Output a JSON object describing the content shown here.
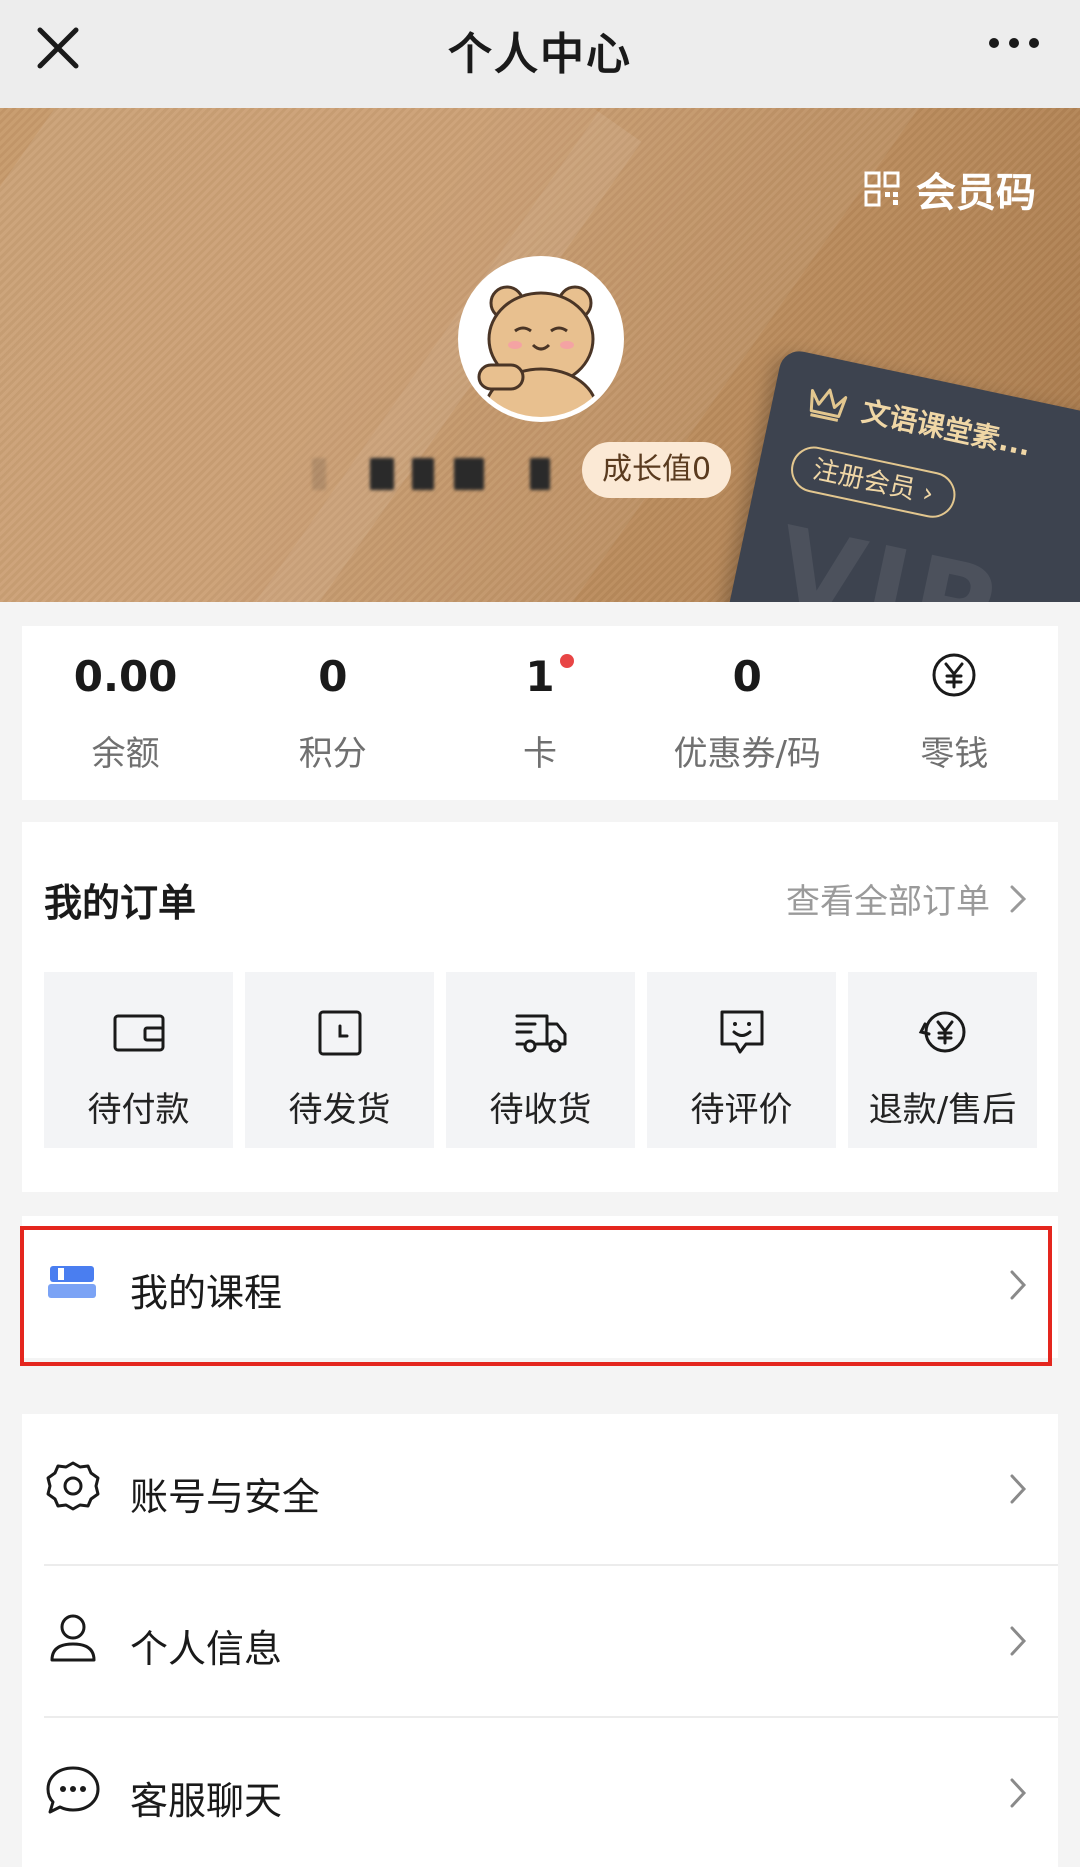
{
  "topbar": {
    "title": "个人中心",
    "close_icon": "close-icon",
    "more_icon": "more-icon"
  },
  "hero": {
    "member_code_label": "会员码",
    "growth_label": "成长值0",
    "vip_card": {
      "name": "文语课堂素...",
      "button": "注册会员 ›",
      "watermark": "VIP"
    },
    "colors": {
      "bg": "#c4976a",
      "card": "#3d434f",
      "gold": "#f0d7a6"
    }
  },
  "stats": [
    {
      "value": "0.00",
      "label": "余额"
    },
    {
      "value": "0",
      "label": "积分"
    },
    {
      "value": "1",
      "label": "卡",
      "has_dot": true
    },
    {
      "value": "0",
      "label": "优惠券/码"
    },
    {
      "icon": "yen-icon",
      "label": "零钱"
    }
  ],
  "orders": {
    "title": "我的订单",
    "view_all": "查看全部订单",
    "items": [
      {
        "label": "待付款",
        "icon": "wallet-icon"
      },
      {
        "label": "待发货",
        "icon": "calendar-clock-icon"
      },
      {
        "label": "待收货",
        "icon": "truck-icon"
      },
      {
        "label": "待评价",
        "icon": "smile-chat-icon"
      },
      {
        "label": "退款/售后",
        "icon": "refund-icon"
      }
    ]
  },
  "courses": {
    "label": "我的课程",
    "icon": "course-icon",
    "accent": "#4a7ef0"
  },
  "settings": [
    {
      "label": "账号与安全",
      "icon": "gear-icon"
    },
    {
      "label": "个人信息",
      "icon": "user-icon"
    },
    {
      "label": "客服聊天",
      "icon": "chat-icon"
    }
  ],
  "highlight_color": "#e4261e"
}
